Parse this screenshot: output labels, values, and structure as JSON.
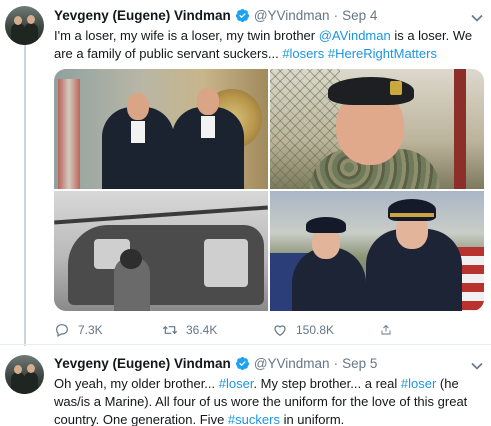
{
  "tweets": [
    {
      "author": {
        "name": "Yevgeny (Eugene) Vindman",
        "handle": "@YVindman",
        "date": "Sep 4"
      },
      "text": {
        "p1": "I'm a loser, my wife is a loser, my twin brother ",
        "mention": "@AVindman",
        "p2": " is a loser. We are a family of public servant suckers... ",
        "tag1": "#losers",
        "p3": " ",
        "tag2": "#HereRightMatters"
      },
      "stats": {
        "replies": "7.3K",
        "retweets": "36.4K",
        "likes": "150.8K"
      },
      "photo_count": 4
    },
    {
      "author": {
        "name": "Yevgeny (Eugene) Vindman",
        "handle": "@YVindman",
        "date": "Sep 5"
      },
      "text": {
        "p1": "Oh yeah, my older brother... ",
        "tag1": "#loser",
        "p2": ". My step brother... a real ",
        "tag2": "#loser",
        "p3": " (he was/is a Marine). All four of us wore the uniform for the love of this great country. One generation. Five ",
        "tag3": "#suckers",
        "p4": " in uniform."
      }
    }
  ],
  "colors": {
    "link": "#1b95e0",
    "verified": "#1da1f2",
    "secondary_text": "#657786",
    "thread_line": "#ccd6dd"
  },
  "icons": [
    "verified-badge-icon",
    "chevron-down-icon",
    "reply-icon",
    "retweet-icon",
    "like-icon",
    "share-icon"
  ]
}
